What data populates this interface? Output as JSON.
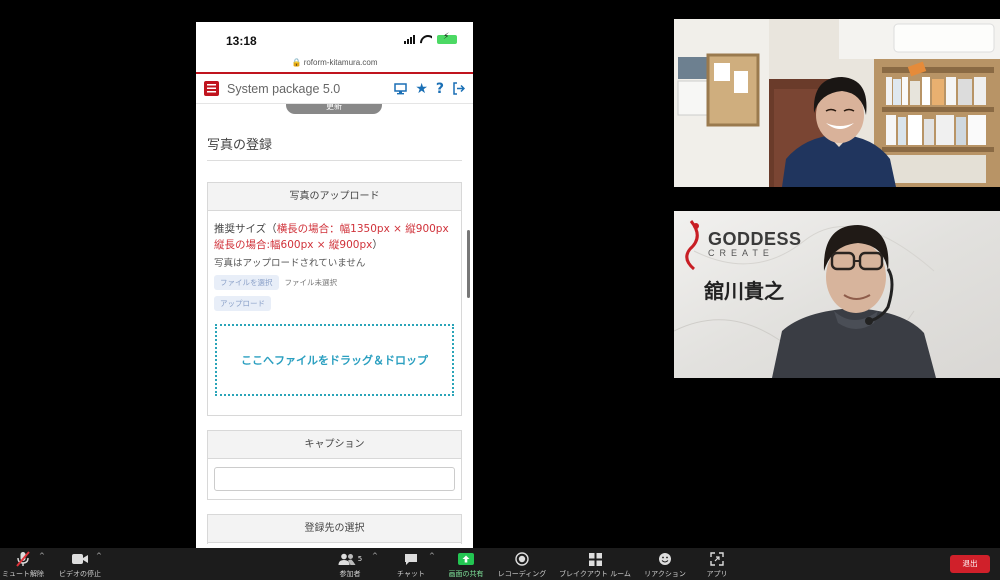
{
  "phone": {
    "time": "13:18",
    "url": "roform-kitamura.com",
    "app_title": "System package 5.0",
    "top_button": "更新",
    "section_title": "写真の登録",
    "upload_card": {
      "header": "写真のアップロード",
      "rec_prefix": "推奨サイズ（",
      "rec_landscape": "横長の場合：幅1350px × 縦900px",
      "rec_portrait": "縦長の場合:幅600px × 縦900px",
      "rec_suffix": "）",
      "no_photo": "写真はアップロードされていません",
      "choose_file": "ファイルを選択",
      "no_file": "ファイル未選択",
      "upload_button": "アップロード",
      "dropzone": "ここへファイルをドラッグ＆ドロップ"
    },
    "caption_card": {
      "header": "キャプション",
      "value": ""
    },
    "dest_card": {
      "header": "登録先の選択"
    }
  },
  "participants": [
    {
      "name": ""
    },
    {
      "name": "舘川貴之",
      "brand_main": "GODDESS",
      "brand_sub": "CREATE"
    }
  ],
  "toolbar": {
    "unmute": "ミュート解除",
    "stop_video": "ビデオの停止",
    "participants": "参加者",
    "participants_count": "5",
    "chat": "チャット",
    "share": "画面の共有",
    "record": "レコーディング",
    "breakout": "ブレイクアウト ルーム",
    "reactions": "リアクション",
    "apps": "アプリ",
    "leave": "退出"
  },
  "colors": {
    "brand_red": "#c0141e",
    "share_green": "#23c552",
    "leave_red": "#d0202a",
    "dropzone": "#2aa4b8"
  }
}
